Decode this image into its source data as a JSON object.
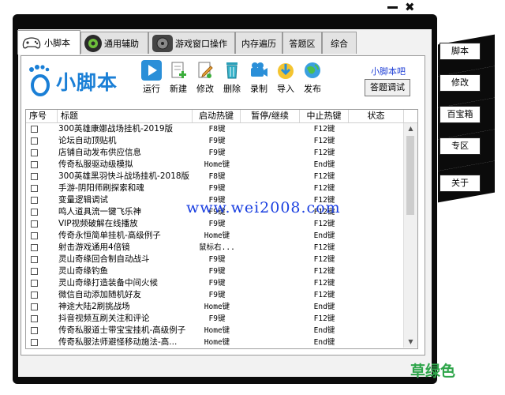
{
  "window": {
    "minimize": "",
    "close": "✖"
  },
  "tabs": [
    {
      "label": "小脚本",
      "icon": "gamepad-icon",
      "active": true
    },
    {
      "label": "通用辅助",
      "icon": "gear-icon"
    },
    {
      "label": "游戏窗口操作",
      "icon": "film-icon"
    },
    {
      "label": "内存遍历"
    },
    {
      "label": "答题区"
    },
    {
      "label": "综合"
    }
  ],
  "logo": {
    "text": "小脚本"
  },
  "toolbar": [
    {
      "label": "运行",
      "icon": "play-icon"
    },
    {
      "label": "新建",
      "icon": "new-doc-icon"
    },
    {
      "label": "修改",
      "icon": "edit-icon"
    },
    {
      "label": "删除",
      "icon": "trash-icon"
    },
    {
      "label": "录制",
      "icon": "record-icon"
    },
    {
      "label": "导入",
      "icon": "import-icon"
    },
    {
      "label": "发布",
      "icon": "globe-icon"
    }
  ],
  "site_link": "小脚本吧",
  "debug_button": "答题调试",
  "table": {
    "columns": [
      "序号",
      "标题",
      "启动热键",
      "暂停/继续",
      "中止热键",
      "状态"
    ],
    "rows": [
      {
        "title": "300英雄康娜战场挂机-2019版",
        "start": "F8键",
        "pause": "",
        "stop": "F12键",
        "status": ""
      },
      {
        "title": "论坛自动顶贴机",
        "start": "F9键",
        "pause": "",
        "stop": "F12键",
        "status": ""
      },
      {
        "title": "店铺自动发布供应信息",
        "start": "F9键",
        "pause": "",
        "stop": "F12键",
        "status": ""
      },
      {
        "title": "传奇私服驱动级模拟",
        "start": "Home键",
        "pause": "",
        "stop": "End键",
        "status": ""
      },
      {
        "title": "300英雄黑羽快斗战场挂机-2018版",
        "start": "F8键",
        "pause": "",
        "stop": "F12键",
        "status": ""
      },
      {
        "title": "手游-阴阳师刷探索和魂",
        "start": "F9键",
        "pause": "",
        "stop": "F12键",
        "status": ""
      },
      {
        "title": "变量逻辑调试",
        "start": "F9键",
        "pause": "",
        "stop": "F12键",
        "status": ""
      },
      {
        "title": "鸣人道具流一键飞乐神",
        "start": "F9键",
        "pause": "",
        "stop": "F12键",
        "status": ""
      },
      {
        "title": "VIP视频破解在线播放",
        "start": "F9键",
        "pause": "",
        "stop": "F12键",
        "status": ""
      },
      {
        "title": "传奇永恒简单挂机-高级例子",
        "start": "Home键",
        "pause": "",
        "stop": "End键",
        "status": ""
      },
      {
        "title": "射击游戏通用4倍镜",
        "start": "鼠标右...",
        "pause": "",
        "stop": "F12键",
        "status": ""
      },
      {
        "title": "灵山奇缘回合制自动战斗",
        "start": "F9键",
        "pause": "",
        "stop": "F12键",
        "status": ""
      },
      {
        "title": "灵山奇缘钓鱼",
        "start": "F9键",
        "pause": "",
        "stop": "F12键",
        "status": ""
      },
      {
        "title": "灵山奇缘打造装备中间火候",
        "start": "F9键",
        "pause": "",
        "stop": "F12键",
        "status": ""
      },
      {
        "title": "微信自动添加随机好友",
        "start": "F9键",
        "pause": "",
        "stop": "F12键",
        "status": ""
      },
      {
        "title": "神途大陆2刷挑战场",
        "start": "Home键",
        "pause": "",
        "stop": "End键",
        "status": ""
      },
      {
        "title": "抖音视频互刷关注和评论",
        "start": "F9键",
        "pause": "",
        "stop": "F12键",
        "status": ""
      },
      {
        "title": "传奇私服道士带宝宝挂机-高级例子",
        "start": "Home键",
        "pause": "",
        "stop": "End键",
        "status": ""
      },
      {
        "title": "传奇私服法师避怪移动施法-高...",
        "start": "Home键",
        "pause": "",
        "stop": "End键",
        "status": ""
      }
    ]
  },
  "watermark": "www.wei2008.com",
  "footer_text": "草绿色",
  "side_buttons": [
    "脚本",
    "修改",
    "百宝箱",
    "专区",
    "关于"
  ],
  "colors": {
    "accent": "#1a7fd6",
    "link": "#1f3fd6",
    "footer": "#2ea54a",
    "frame": "#0b0b0b"
  }
}
